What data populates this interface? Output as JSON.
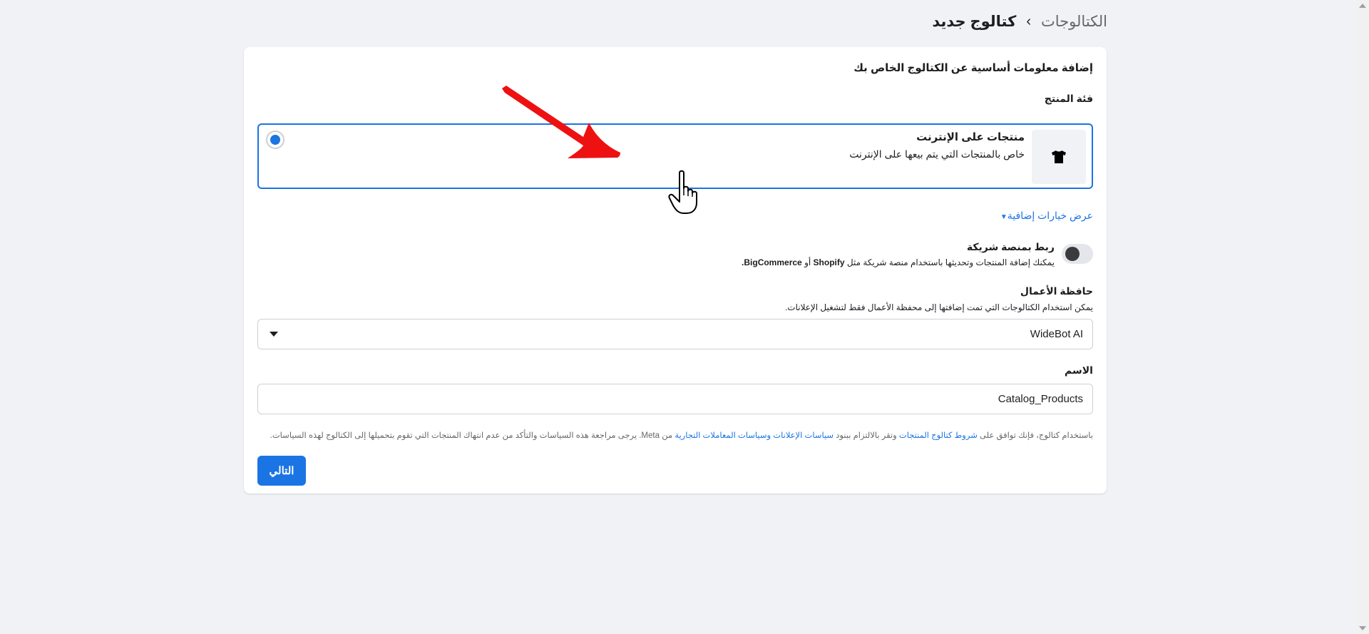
{
  "breadcrumb": {
    "parent": "الكتالوجات",
    "separator": "›",
    "current": "كتالوج جديد"
  },
  "form": {
    "heading": "إضافة معلومات أساسية عن الكتالوج الخاص بك",
    "category_label": "فئة المنتج",
    "category": {
      "title": "منتجات على الإنترنت",
      "description": "خاص بالمنتجات التي يتم بيعها على الإنترنت",
      "icon": "tshirt-icon",
      "selected": true
    },
    "more_options": "عرض خيارات إضافية",
    "partner": {
      "title": "ربط بمنصة شريكة",
      "desc_prefix": "يمكنك إضافة المنتجات وتحديثها باستخدام منصة شريكة مثل",
      "shopify": "Shopify",
      "or": "أو",
      "bigcommerce": "BigCommerce.",
      "toggle_on": false
    },
    "business": {
      "title": "حافظة الأعمال",
      "description": "يمكن استخدام الكتالوجات التي تمت إضافتها إلى محفظة الأعمال فقط لتشغيل الإعلانات.",
      "selected_value": "WideBot AI"
    },
    "name": {
      "label": "الاسم",
      "value": "Catalog_Products"
    },
    "terms": {
      "part1": "باستخدام كتالوج، فإنك توافق على",
      "link1": "شروط كتالوج المنتجات",
      "part2": "وتقر بالالتزام ببنود",
      "link2": "سياسات الإعلانات وسياسات المعاملات التجارية",
      "part3": "من Meta. يرجى مراجعة هذه السياسات والتأكد من عدم انتهاك المنتجات التي تقوم بتحميلها إلى الكتالوج لهذه السياسات."
    },
    "next_button": "التالي"
  },
  "colors": {
    "accent": "#1b74e4",
    "background": "#f0f2f5",
    "arrow": "#ee1111"
  }
}
